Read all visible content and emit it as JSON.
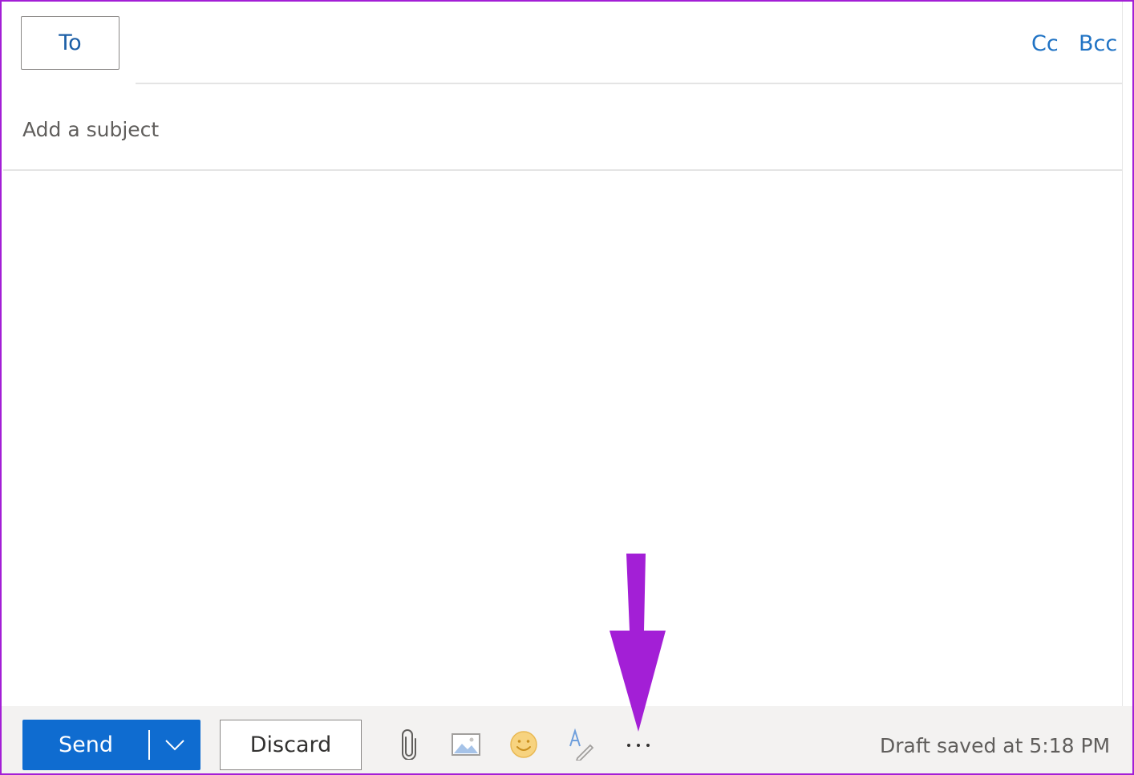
{
  "compose": {
    "to_label": "To",
    "cc_label": "Cc",
    "bcc_label": "Bcc",
    "subject_placeholder": "Add a subject",
    "subject_value": "",
    "body_value": ""
  },
  "toolbar": {
    "send_label": "Send",
    "send_options_icon": "chevron-down-icon",
    "discard_label": "Discard",
    "tools": [
      {
        "icon": "paperclip-icon",
        "label": "Attach"
      },
      {
        "icon": "image-icon",
        "label": "Insert pictures inline"
      },
      {
        "icon": "emoji-icon",
        "label": "Insert emojis"
      },
      {
        "icon": "signature-icon",
        "label": "Insert signature"
      },
      {
        "icon": "more-options-icon",
        "label": "More options"
      }
    ],
    "status_text": "Draft saved at 5:18 PM"
  },
  "annotation": {
    "shape": "arrow-down",
    "target": "more-options-button",
    "color": "#a31fd6"
  },
  "colors": {
    "accent": "#0f6cd0",
    "link": "#2073c4",
    "frame": "#a31fd6",
    "toolbar_background": "#f3f2f1"
  }
}
